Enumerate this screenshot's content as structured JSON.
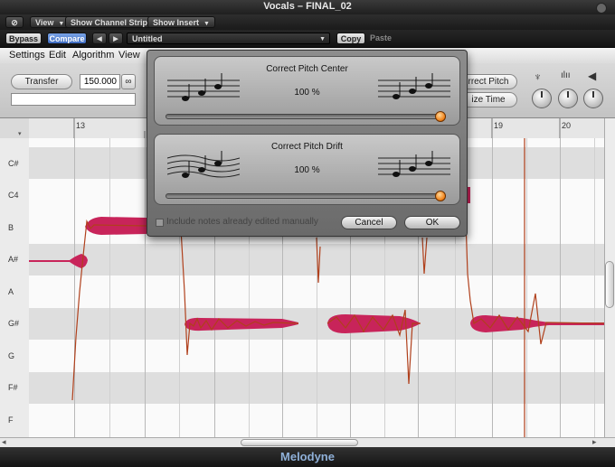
{
  "window": {
    "title": "Vocals – FINAL_02"
  },
  "header": {
    "view_label": "View",
    "channel_strip_label": "Show Channel Strip",
    "insert_label": "Show Insert",
    "bypass_label": "Bypass",
    "compare_label": "Compare",
    "prev_label": "◀",
    "next_label": "▶",
    "preset_name": "Untitled",
    "copy_label": "Copy",
    "paste_label": "Paste"
  },
  "menu": {
    "items": [
      "Settings",
      "Edit",
      "Algorithm",
      "View"
    ]
  },
  "toolbar": {
    "transfer_label": "Transfer",
    "tempo_value": "150.000",
    "correct_pitch_label": "rrect Pitch",
    "quantize_time_label": "ize Time"
  },
  "ruler": {
    "bar_numbers": [
      "13",
      "19",
      "20"
    ]
  },
  "keyboard": {
    "notes": [
      "C#",
      "C4",
      "B",
      "A#",
      "A",
      "G#",
      "G",
      "F#",
      "F"
    ]
  },
  "dialog": {
    "pitch_center": {
      "title": "Correct Pitch Center",
      "value": "100 %",
      "amount": 1.0
    },
    "pitch_drift": {
      "title": "Correct Pitch Drift",
      "value": "100 %",
      "amount": 1.0
    },
    "include_manual_label": "Include notes already edited manually",
    "include_manual_checked": false,
    "cancel_label": "Cancel",
    "ok_label": "OK"
  },
  "footer": {
    "brand": "Melodyne"
  },
  "colors": {
    "note_blob": "#c8245a",
    "pitch_curve": "#b0401c",
    "accent": "#f07c10"
  }
}
